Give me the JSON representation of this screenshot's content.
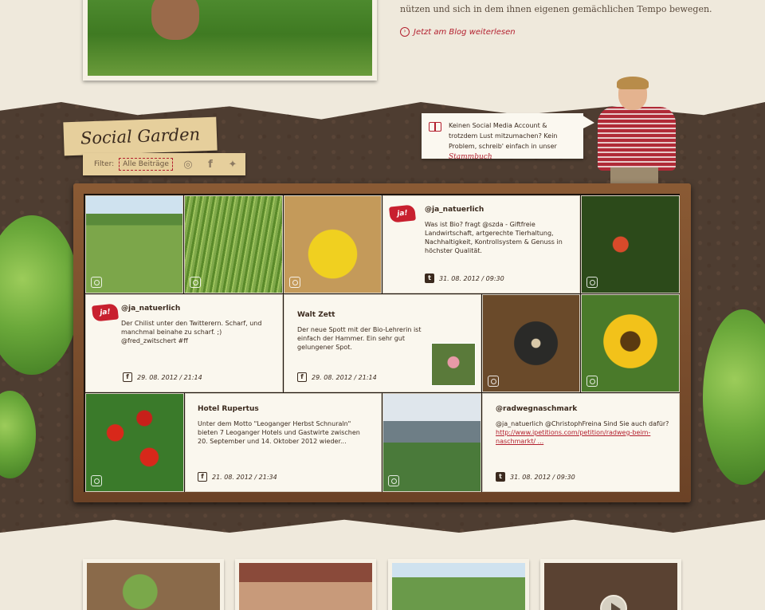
{
  "hero": {
    "blog_text": "nützen und sich in dem ihnen eigenen gemächlichen Tempo bewegen.",
    "blog_link": "Jetzt am Blog weiterlesen"
  },
  "social_garden": {
    "title": "Social Garden",
    "filter_label": "Filter:",
    "filter_value": "Alle Beiträge",
    "filter_icons": [
      "instagram-icon",
      "facebook-icon",
      "twitter-icon"
    ]
  },
  "bubble": {
    "text": "Keinen Social Media Account & trotzdem Lust mitzumachen? Kein Problem, schreib' einfach in unser",
    "link": "Stammbuch"
  },
  "posts": [
    {
      "name": "@ja_natuerlich",
      "body": "Was ist Bio? fragt @szda - Giftfreie Landwirtschaft, artgerechte Tierhaltung, Nachhaltigkeit, Kontrollsystem & Genuss in höchster Qualität.",
      "network": "twitter",
      "date": "31. 08. 2012 / 09:30",
      "logo": "ja!"
    },
    {
      "name": "@ja_natuerlich",
      "body": "Der Chilist unter den Twitterern. Scharf, und manchmal beinahe zu scharf. ;) @fred_zwitschert #ff",
      "network": "facebook",
      "date": "29. 08. 2012 / 21:14",
      "logo": "ja!"
    },
    {
      "name": "Walt Zett",
      "body": "Der neue Spott mit der Bio-Lehrerin ist einfach der Hammer.  Ein sehr gut gelungener Spot.",
      "network": "facebook",
      "date": "29. 08. 2012 / 21:14"
    },
    {
      "name": "Hotel Rupertus",
      "body": "Unter dem Motto \"Leoganger Herbst Schnuraln\" bieten 7 Leoganger Hotels und Gastwirte zwischen 20. September und 14. Oktober 2012 wieder...",
      "network": "facebook",
      "date": "21. 08. 2012 / 21:34"
    },
    {
      "name": "@radwegnaschmark",
      "body": "@ja_natuerlich @ChristophFreina Sind Sie auch dafür?",
      "link": "http://www.ipetitions.com/petition/radweg-beim-naschmarkt/ ...",
      "network": "twitter",
      "date": "31. 08. 2012 / 09:30"
    }
  ],
  "network_glyphs": {
    "facebook": "f",
    "twitter": "t"
  },
  "colors": {
    "accent": "#b3202f",
    "soil": "#4e3d31",
    "frame": "#8a5a34",
    "paper": "#faf7ee"
  }
}
